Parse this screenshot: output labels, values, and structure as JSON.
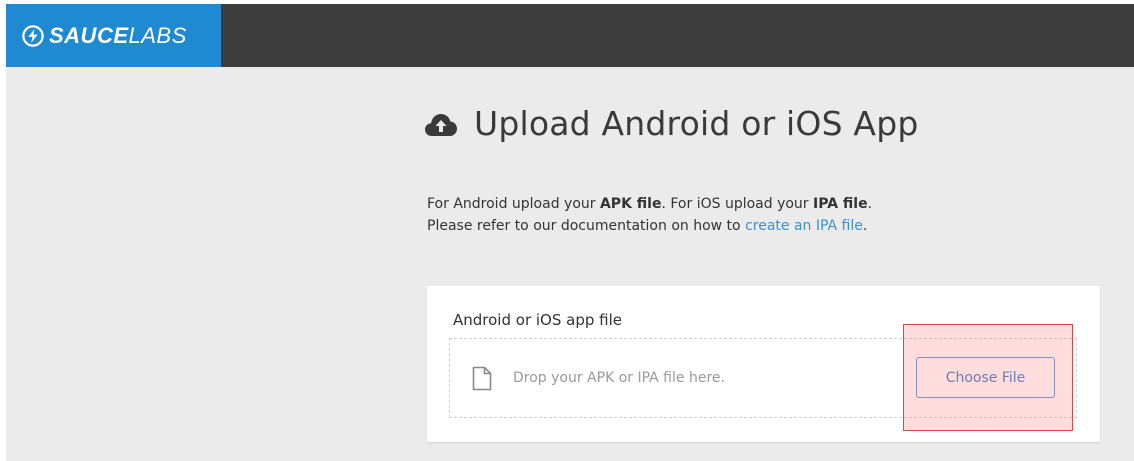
{
  "brand": {
    "name_bold": "SAUCE",
    "name_light": "LABS"
  },
  "page": {
    "title": "Upload Android or iOS App"
  },
  "description": {
    "line1_prefix": "For Android upload your ",
    "line1_bold1": "APK file",
    "line1_mid": ". For iOS upload your ",
    "line1_bold2": "IPA file",
    "line1_suffix": ".",
    "line2_prefix": "Please refer to our documentation on how to ",
    "line2_link": "create an IPA file",
    "line2_suffix": "."
  },
  "upload": {
    "label": "Android or iOS app file",
    "drop_text": "Drop your APK or IPA file here.",
    "button_label": "Choose File"
  },
  "colors": {
    "brand_blue": "#1f8ad2",
    "topbar": "#3d3d3d",
    "background": "#ebebeb",
    "link": "#3d8fd6",
    "highlight_border": "#e04545"
  }
}
